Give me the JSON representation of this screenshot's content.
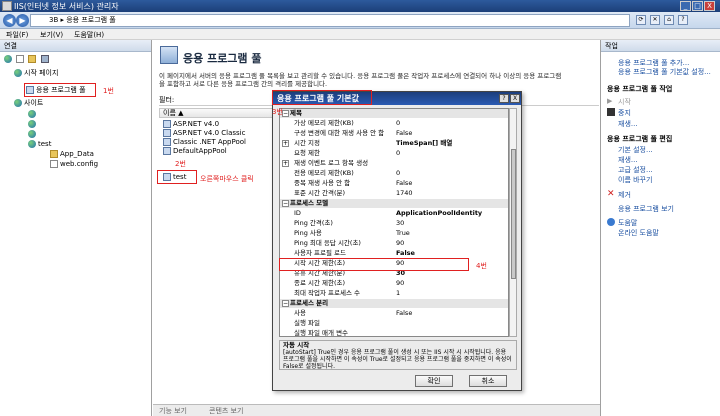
{
  "window": {
    "title": "IIS(인터넷 정보 서비스) 관리자",
    "controls": [
      "_",
      "□",
      "X"
    ]
  },
  "address": {
    "path": "3B  ▸  응용 프로그램 풀",
    "icon_names": [
      "refresh-icon",
      "stop-icon",
      "home-icon",
      "help-icon"
    ]
  },
  "menu": {
    "items": [
      "파일(F)",
      "보기(V)",
      "도움말(H)"
    ]
  },
  "connections": {
    "header": "연결",
    "start_page": "시작 페이지",
    "app_pools": "응용 프로그램 풀",
    "sites": "사이트",
    "site_test": "test",
    "app_data": "App_Data",
    "web_config": "web.config"
  },
  "center": {
    "title": "응용 프로그램 풀",
    "description_line1": "이 페이지에서 서버의 응용 프로그램 풀 목록을 보고 관리할 수 있습니다. 응용 프로그램 풀은 작업자 프로세스에 연결되어 하나 이상의 응용 프로그램",
    "description_line2": "을 포함하고 서로 다른 응용 프로그램 간의 격리를 제공합니다.",
    "filter_label": "필터:",
    "list_header": "이름 ▲",
    "pools": [
      "ASP.NET v4.0",
      "ASP.NET v4.0 Classic",
      "Classic .NET AppPool",
      "DefaultAppPool",
      "test"
    ],
    "view_features": "기능 보기",
    "view_content": "콘텐츠 보기"
  },
  "dialog": {
    "title": "응용 프로그램 풀 기본값",
    "help_btn": "?",
    "close_btn": "X",
    "rows": [
      {
        "type": "sec",
        "k": "제목",
        "v": ""
      },
      {
        "type": "row",
        "k": "가상 메모리 제한(KB)",
        "v": "0",
        "bold": false
      },
      {
        "type": "row",
        "k": "구성 변경에 대한 재생 사용 안 함",
        "v": "False",
        "bold": false
      },
      {
        "type": "row",
        "k": "시간 지정",
        "v": "TimeSpan[] 배열",
        "bold": true,
        "exp": "+"
      },
      {
        "type": "row",
        "k": "요청 제한",
        "v": "0",
        "bold": false
      },
      {
        "type": "row",
        "k": "재생 이벤트 로그 항목 생성",
        "v": "",
        "bold": false,
        "exp": "+"
      },
      {
        "type": "row",
        "k": "전용 메모리 제한(KB)",
        "v": "0",
        "bold": false
      },
      {
        "type": "row",
        "k": "중복 재생 사용 안 함",
        "v": "False",
        "bold": false
      },
      {
        "type": "row",
        "k": "표준 시간 간격(분)",
        "v": "1740",
        "bold": false
      },
      {
        "type": "sec",
        "k": "프로세스 모델",
        "v": ""
      },
      {
        "type": "row",
        "k": "ID",
        "v": "ApplicationPoolIdentity",
        "bold": true
      },
      {
        "type": "row",
        "k": "Ping 간격(초)",
        "v": "30",
        "bold": false
      },
      {
        "type": "row",
        "k": "Ping 사용",
        "v": "True",
        "bold": false
      },
      {
        "type": "row",
        "k": "Ping 최대 응답 시간(초)",
        "v": "90",
        "bold": false
      },
      {
        "type": "row",
        "k": "사용자 프로필 로드",
        "v": "False",
        "bold": true
      },
      {
        "type": "row",
        "k": "시작 시간 제한(초)",
        "v": "90",
        "bold": false
      },
      {
        "type": "row",
        "k": "유휴 시간 제한(분)",
        "v": "30",
        "bold": true
      },
      {
        "type": "row",
        "k": "종료 시간 제한(초)",
        "v": "90",
        "bold": false
      },
      {
        "type": "row",
        "k": "최대 작업자 프로세스 수",
        "v": "1",
        "bold": false
      },
      {
        "type": "sec",
        "k": "프로세스 분리",
        "v": ""
      },
      {
        "type": "row",
        "k": "사용",
        "v": "False",
        "bold": false
      },
      {
        "type": "row",
        "k": "실행 파일",
        "v": "",
        "bold": false
      },
      {
        "type": "row",
        "k": "실행 파일 매개 변수",
        "v": "",
        "bold": false
      }
    ],
    "desc_title": "자동 시작",
    "desc_text": "[autoStart] True인 경우 응용 프로그램 풀이 생성 시 또는 IIS 시작 시 시작됩니다. 응용 프로그램 풀을 시작하면 이 속성이 True로 설정되고 응용 프로그램 풀을 중지하면 이 속성이 False로 설정됩니다.",
    "ok": "확인",
    "cancel": "취소"
  },
  "actions": {
    "header": "작업",
    "add_pool": "응용 프로그램 풀 추가...",
    "set_defaults": "응용 프로그램 풀 기본값 설정...",
    "pool_tasks": "응용 프로그램 풀 작업",
    "start": "시작",
    "stop": "중지",
    "recycle": "재생...",
    "edit_pool": "응용 프로그램 풀 편집",
    "basic_settings": "기본 설정...",
    "recycling": "재생...",
    "advanced": "고급 설정...",
    "rename": "이름 바꾸기",
    "remove": "제거",
    "view_apps": "응용 프로그램 보기",
    "help": "도움말",
    "online_help": "온라인 도움말"
  },
  "annotations": {
    "a1": "1번",
    "a2": "2번",
    "a2b": "오른쪽마우스 클릭",
    "a3": "3번",
    "a4": "4번"
  },
  "colors": {
    "accent_red": "#e02020",
    "title_blue": "#1c3f78",
    "link_blue": "#1a4fa0"
  }
}
